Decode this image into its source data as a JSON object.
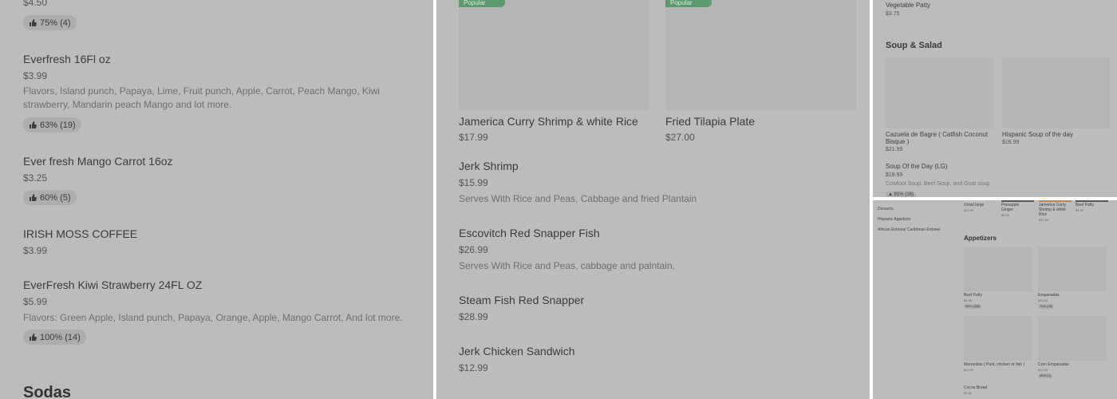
{
  "colors": {
    "panel_bg": "#bcbcbc",
    "popular_badge": "#5d9a70",
    "rating_pill": "#adadad"
  },
  "icons": {
    "rating": "thumbs-up-icon"
  },
  "panel1": {
    "top_price": "$4.50",
    "top_rating": "75% (4)",
    "items": [
      {
        "name": "Everfresh 16Fl oz",
        "price": "$3.99",
        "desc_line1": "Flavors, Island punch, Papaya, Lime, Fruit punch, Apple, Carrot, Peach Mango, Kiwi",
        "desc_line2": "strawberry, Mandarin peach Mango and lot more.",
        "rating": "63% (19)"
      },
      {
        "name": "Ever fresh Mango Carrot 16oz",
        "price": "$3.25",
        "rating": "60% (5)"
      },
      {
        "name": "IRISH MOSS COFFEE",
        "price": "$3.99"
      },
      {
        "name": "EverFresh Kiwi Strawberry 24FL OZ",
        "price": "$5.99",
        "desc": "Flavors: Green Apple, Island punch, Papaya, Orange, Apple, Mango Carrot, And lot more.",
        "rating": "100% (14)"
      }
    ],
    "section_title": "Sodas"
  },
  "panel2": {
    "badge": "Popular",
    "cards": [
      {
        "name": "Jamerica Curry Shrimp & white Rice",
        "price": "$17.99"
      },
      {
        "name": "Fried Tilapia Plate",
        "price": "$27.00"
      }
    ],
    "items": [
      {
        "name": "Jerk Shrimp",
        "price": "$15.99",
        "desc": "Serves With Rice and Peas, Cabbage and fried Plantain"
      },
      {
        "name": "Escovitch Red Snapper Fish",
        "price": "$26.99",
        "desc": "Serves With Rice and Peas, cabbage and palntain."
      },
      {
        "name": "Steam Fish Red Snapper",
        "price": "$28.99"
      },
      {
        "name": "Jerk Chicken Sandwich",
        "price": "$12.99"
      }
    ]
  },
  "panel3": {
    "top_item": {
      "name": "Vegetable Patty",
      "price": "$3.75"
    },
    "section_title": "Soup & Salad",
    "cards": [
      {
        "name_line1": "Cazuela de Bagre ( Catfish Coconut",
        "name_line2": "Bisque )",
        "price": "$21.99"
      },
      {
        "name": "Hispanic Soup of the day",
        "price": "$16.99"
      }
    ],
    "list_item": {
      "name": "Soup Of the Day (LG)",
      "price": "$18.99",
      "desc": "Cowfoot Soup, Beef Soup, and Goat soup",
      "rating": "81% (16)"
    }
  },
  "panel4": {
    "sidebar": [
      "Desserts",
      "Hispanic Appetizer",
      "African Entrees/ Caribbean Entrees"
    ],
    "top_row": [
      {
        "name": "Oxtail large",
        "price": "$21.99"
      },
      {
        "name_line1": "Pineapple",
        "name_line2": "Ginger",
        "price": "$5.00"
      },
      {
        "name_line1": "Jamerica Curry",
        "name_line2": "Shrimp & white",
        "name_line3": "Rice",
        "price": "$17.99"
      },
      {
        "name": "Beef Patty",
        "price": "$4.55"
      }
    ],
    "section_title": "Appetizers",
    "cards": [
      {
        "name": "Beef Patty",
        "price": "$4.55",
        "rating": "90% (280)"
      },
      {
        "name": "Empanadas",
        "price": "$10.00",
        "rating": "75% (28)"
      },
      {
        "name": "Marranitas  ( Pork, chicken or fish )",
        "price": "$12.99"
      },
      {
        "name": "Corn Empanadas",
        "price": "$10.00",
        "rating": "88% (2)"
      }
    ],
    "bottom_item": {
      "name": "Cocoa Bread",
      "price": "$2.50"
    }
  }
}
